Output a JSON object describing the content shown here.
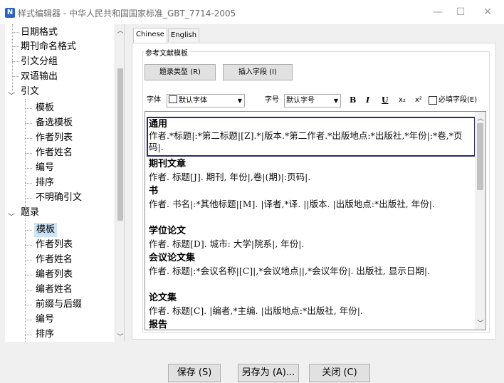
{
  "window": {
    "title": "样式编辑器 - 中华人民共和国国家标准_GBT_7714-2005",
    "minimize": "—",
    "maximize": "☐",
    "close": "✕"
  },
  "tree": {
    "items": [
      {
        "label": "日期格式"
      },
      {
        "label": "期刊命名格式"
      },
      {
        "label": "引文分组"
      },
      {
        "label": "双语输出"
      },
      {
        "label": "引文"
      },
      {
        "label": "模板"
      },
      {
        "label": "备选模板"
      },
      {
        "label": "作者列表"
      },
      {
        "label": "作者姓名"
      },
      {
        "label": "编号"
      },
      {
        "label": "排序"
      },
      {
        "label": "不明确引文"
      },
      {
        "label": "题录"
      },
      {
        "label": "模板"
      },
      {
        "label": "作者列表"
      },
      {
        "label": "作者姓名"
      },
      {
        "label": "编者列表"
      },
      {
        "label": "编者姓名"
      },
      {
        "label": "前缀与后缀"
      },
      {
        "label": "编号"
      },
      {
        "label": "排序"
      }
    ]
  },
  "tabs": [
    "Chinese",
    "English"
  ],
  "group": {
    "title": "参考文献模板"
  },
  "buttons": {
    "record_type": "题录类型 (R)",
    "insert_field": "插入字段 (I)"
  },
  "format": {
    "font_label": "字体",
    "font_value": "默认字体",
    "size_label": "字号",
    "size_value": "默认字号",
    "bold": "B",
    "italic": "I",
    "underline": "U",
    "subscript": "x₂",
    "superscript": "x²",
    "required_field": "必填字段(E)"
  },
  "entries": [
    {
      "title": "通用",
      "body": "作者.*标题|:*第二标题|[Z].*|版本.*第二作者.*出版地点:*出版社,*年份|:*卷,*页码|."
    },
    {
      "title": "期刊文章",
      "body": "作者. 标题[J]. 期刊, 年份|,卷|(期)|:页码|."
    },
    {
      "title": "书",
      "body": "作者. 书名|:*其他标题|[M]. |译者,*译. ||版本. |出版地点:*出版社, 年份|."
    },
    {
      "title": "学位论文",
      "body": "作者. 标题[D]. 城市: 大学|院系|, 年份|."
    },
    {
      "title": "会议论文集",
      "body": "作者. 标题|:*会议名称|[C]|,*会议地点||,*会议年份|. 出版社, 显示日期|."
    },
    {
      "title": "论文集",
      "body": "作者. 标题[C]. |编者,*主编. |出版地点:*出版社, 年份|."
    },
    {
      "title": "报告",
      "body": ""
    }
  ],
  "footer": {
    "save": "保存 (S)",
    "save_as": "另存为 (A)...",
    "close": "关闭 (C)"
  },
  "colors": {
    "selected_bg": "#cce4f7",
    "highlight_border": "#2a2a6c",
    "app_icon": "#2b63c6"
  }
}
